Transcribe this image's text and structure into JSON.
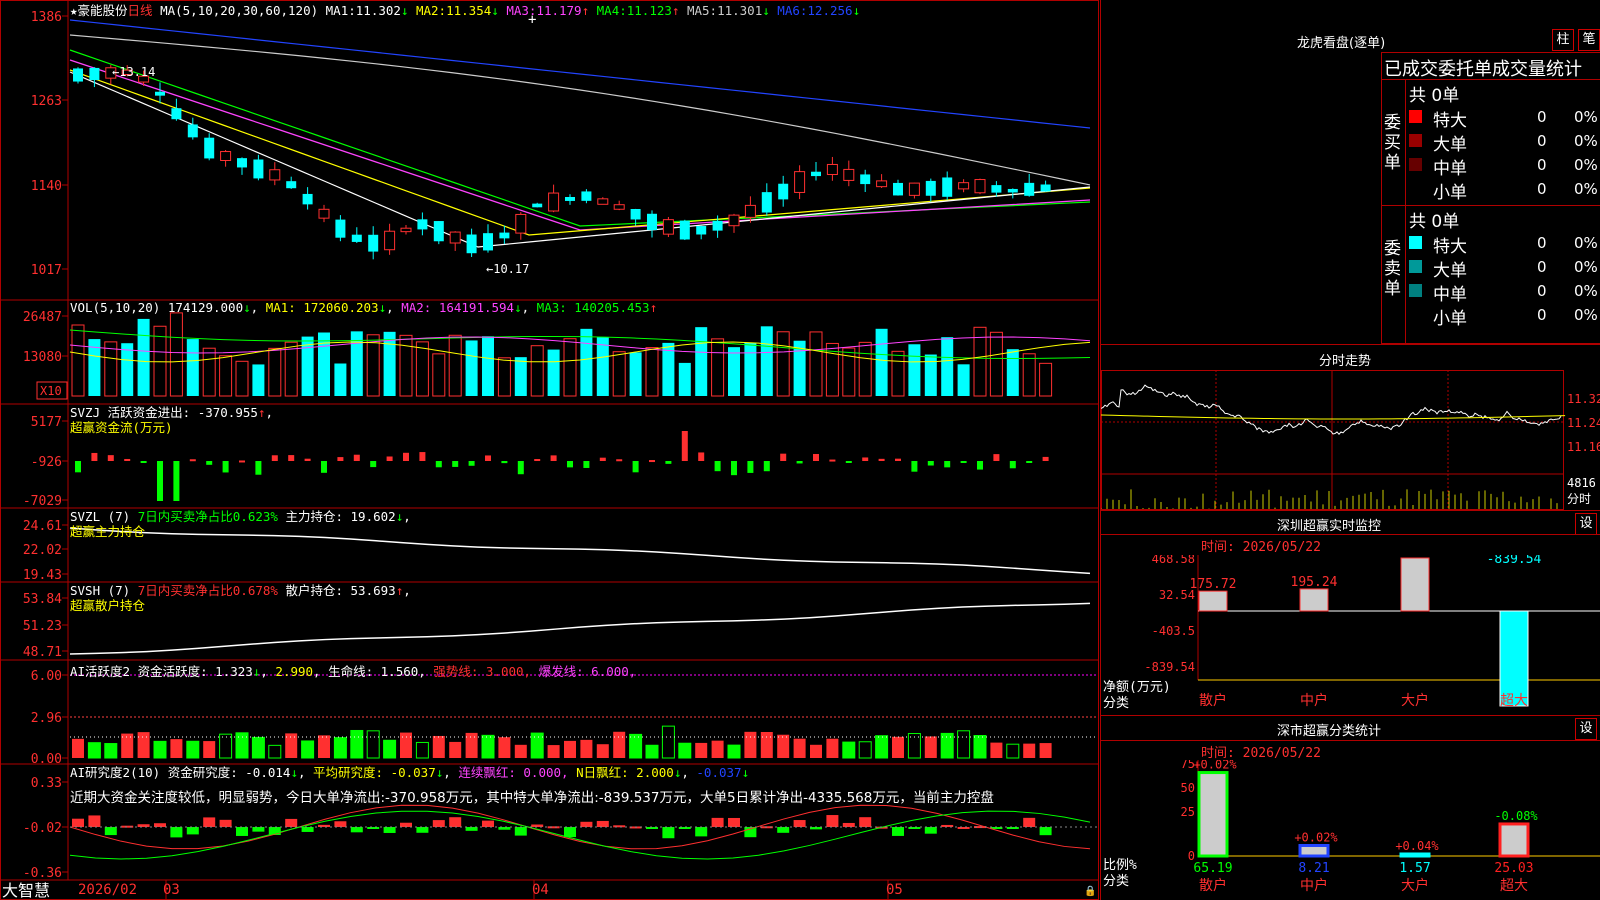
{
  "stock": {
    "name": "★豪能股份",
    "period": "日线",
    "ma_label": "MA(5,10,20,30,60,120)",
    "ma": [
      {
        "label": "MA1:",
        "value": "11.302",
        "arrow": "↓",
        "color": "#ffffff"
      },
      {
        "label": "MA2:",
        "value": "11.354",
        "arrow": "↓",
        "color": "#ffff00"
      },
      {
        "label": "MA3:",
        "value": "11.179",
        "arrow": "↑",
        "color": "#ff44ff"
      },
      {
        "label": "MA4:",
        "value": "11.123",
        "arrow": "↑",
        "color": "#00ff00"
      },
      {
        "label": "MA5:",
        "value": "11.301",
        "arrow": "↓",
        "color": "#cccccc"
      },
      {
        "label": "MA6:",
        "value": "12.256",
        "arrow": "↓",
        "color": "#2244ff"
      }
    ]
  },
  "price_axis": [
    "1386",
    "1263",
    "1140",
    "1017"
  ],
  "price_marks": {
    "high": "13.14",
    "low": "10.17"
  },
  "vol": {
    "label": "VOL(5,10,20)",
    "value": "174129.000",
    "arrow": "↓",
    "ma1": "MA1: 172060.203",
    "ma1_arrow": "↓",
    "ma2": "MA2: 164191.594",
    "ma2_arrow": "↓",
    "ma3": "MA3: 140205.453",
    "ma3_arrow": "↑",
    "axis": [
      "26487",
      "13080"
    ],
    "scale": "X10"
  },
  "svzj": {
    "label": "SVZJ",
    "sub": "活跃资金进出: -370.955",
    "arrow": "↑",
    "title": "超赢资金流(万元)",
    "axis": [
      "5177",
      "-926",
      "-7029"
    ]
  },
  "svzl": {
    "label": "SVZL (7)",
    "ratio": "7日内买卖净占比0.623%",
    "hold": "主力持仓: 19.602",
    "arrow": "↓",
    "comma": ",",
    "title": "超赢主力持仓",
    "axis": [
      "24.61",
      "22.02",
      "19.43"
    ]
  },
  "svsh": {
    "label": "SVSH (7)",
    "ratio": "7日内买卖净占比0.678%",
    "hold": "散户持仓: 53.693",
    "arrow": "↑",
    "comma": ",",
    "title": "超赢散户持仓",
    "axis": [
      "53.84",
      "51.23",
      "48.71"
    ]
  },
  "ai1": {
    "label": "AI活跃度2",
    "activity": "资金活跃度: 1.323",
    "arrow": "↓",
    "v2": "2.990",
    "life": "生命线: 1.560,",
    "strong": "强势线: 3.000,",
    "burst": "爆发线: 6.000,",
    "axis": [
      "6.00",
      "2.96",
      "0.00"
    ]
  },
  "ai2": {
    "label": "AI研究度2(10)",
    "research": "资金研究度: -0.014",
    "arrow1": "↓",
    "avg": "平均研究度: -0.037",
    "arrow2": "↓",
    "red1": "连续飘红: 0.000,",
    "red2": "N日飘红: 2.000",
    "arrow3": "↓",
    "last": "-0.037",
    "arrow4": "↓",
    "axis": [
      "0.33",
      "-0.02",
      "-0.36"
    ],
    "comment": "近期大资金关注度较低，明显弱势，今日大单净流出:-370.958万元，其中特大单净流出:-839.537万元，大单5日累计净出-4335.568万元，当前主力控盘"
  },
  "timeline": {
    "brand": "大智慧",
    "labels": [
      "2026/02",
      "03",
      "04",
      "05"
    ]
  },
  "dragon": {
    "title": "龙虎看盘(逐单)",
    "btn1": "柱",
    "btn2": "笔",
    "header": "已成交委托单成交量统计",
    "buy_label": "委买单",
    "sell_label": "委卖单",
    "buy_total": "共 0单",
    "sell_total": "共 0单",
    "buy_rows": [
      {
        "name": "特大",
        "count": "0",
        "pct": "0%",
        "color": "#ff0000"
      },
      {
        "name": "大单",
        "count": "0",
        "pct": "0%",
        "color": "#990000"
      },
      {
        "name": "中单",
        "count": "0",
        "pct": "0%",
        "color": "#660000"
      },
      {
        "name": "小单",
        "count": "0",
        "pct": "0%",
        "color": ""
      }
    ],
    "sell_rows": [
      {
        "name": "特大",
        "count": "0",
        "pct": "0%",
        "color": "#00ffff"
      },
      {
        "name": "大单",
        "count": "0",
        "pct": "0%",
        "color": "#009999"
      },
      {
        "name": "中单",
        "count": "0",
        "pct": "0%",
        "color": "#008080"
      },
      {
        "name": "小单",
        "count": "0",
        "pct": "0%",
        "color": ""
      }
    ]
  },
  "intraday": {
    "title": "分时走势",
    "axis": [
      "11.32",
      "11.24",
      "11.16"
    ],
    "vol": "4816",
    "unit": "分时"
  },
  "monitor": {
    "title": "深圳超赢实时监控",
    "settings": "设",
    "time": "时间: 2026/05/22",
    "axis": [
      "468.58",
      "32.54",
      "-403.5",
      "-839.54"
    ],
    "ylabel": "净额(万元)",
    "xlabel": "分类",
    "bars": [
      {
        "cat": "散户",
        "value": 175.72,
        "label": "175.72"
      },
      {
        "cat": "中户",
        "value": 195.24,
        "label": "195.24"
      },
      {
        "cat": "大户",
        "value": 468.58,
        "label": "468.58"
      },
      {
        "cat": "超大",
        "value": -839.54,
        "label": "-839.54"
      }
    ]
  },
  "classify": {
    "title": "深市超赢分类统计",
    "settings": "设",
    "time": "时间: 2026/05/22",
    "axis": [
      "75",
      "50",
      "25",
      "0"
    ],
    "ylabel": "比例%",
    "xlabel": "分类",
    "bars": [
      {
        "cat": "散户",
        "value": 65.19,
        "delta": "+0.02%",
        "label": "65.19",
        "color": "#00ff00"
      },
      {
        "cat": "中户",
        "value": 8.21,
        "delta": "+0.02%",
        "label": "8.21",
        "color": "#2244ff"
      },
      {
        "cat": "大户",
        "value": 1.57,
        "delta": "+0.04%",
        "label": "1.57",
        "color": "#00ffff"
      },
      {
        "cat": "超大",
        "value": 25.03,
        "delta": "-0.08%",
        "label": "25.03",
        "color": "#ff2020"
      }
    ]
  }
}
